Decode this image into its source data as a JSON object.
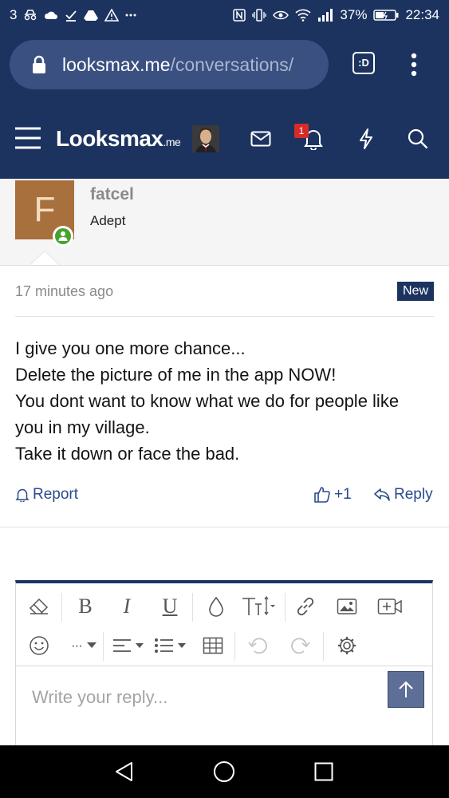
{
  "status_bar": {
    "notif_count": "3",
    "battery": "37%",
    "time": "22:34"
  },
  "browser": {
    "url_host": "looksmax.me",
    "url_path": "/conversations/",
    "tabs_label": ":D"
  },
  "site_nav": {
    "logo_main": "Looksmax",
    "logo_suffix": ".me",
    "alerts_count": "1"
  },
  "post": {
    "avatar_letter": "F",
    "username": "fatcel",
    "user_title": "Adept",
    "timestamp": "17 minutes ago",
    "new_badge": "New",
    "lines": [
      "I give you one more chance...",
      "Delete the picture of me in the app NOW!",
      "You dont want to know what we do for people like",
      "you in my village.",
      "Take it down or face the bad."
    ],
    "report_label": "Report",
    "like_count": "+1",
    "reply_label": "Reply"
  },
  "editor": {
    "placeholder": "Write your reply...",
    "more_label": "···"
  },
  "colors": {
    "header_bg": "#1c3360",
    "avatar_bg": "#a8703c",
    "link": "#2a4a8c",
    "alert_badge": "#d72b2b",
    "online": "#46a22e"
  }
}
